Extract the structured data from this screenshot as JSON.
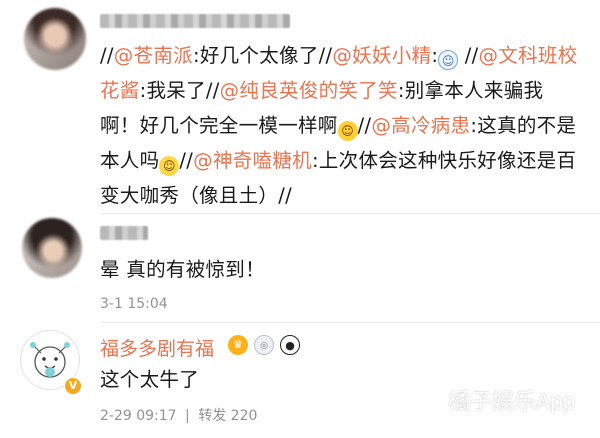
{
  "comments": [
    {
      "body_segments": [
        {
          "text": "//",
          "type": "plain"
        },
        {
          "text": "@苍南派",
          "type": "mention"
        },
        {
          "text": ":好几个太像了//",
          "type": "plain"
        },
        {
          "text": "@妖妖小精",
          "type": "mention"
        },
        {
          "text": ":",
          "type": "plain"
        },
        {
          "icon": "ghost-emoji",
          "type": "emoji"
        },
        {
          "text": " //",
          "type": "plain"
        },
        {
          "text": "@文科班校花酱",
          "type": "mention"
        },
        {
          "text": ":我呆了//",
          "type": "plain"
        },
        {
          "text": "@纯良英俊的笑了笑",
          "type": "mention"
        },
        {
          "text": ":别拿本人来骗我啊！好几个完全一模一样啊",
          "type": "plain"
        },
        {
          "icon": "laughing-tears-emoji",
          "type": "emoji"
        },
        {
          "text": "//",
          "type": "plain"
        },
        {
          "text": "@高冷病患",
          "type": "mention"
        },
        {
          "text": ":这真的不是本人吗",
          "type": "plain"
        },
        {
          "icon": "smug-emoji",
          "type": "emoji"
        },
        {
          "text": "//",
          "type": "plain"
        },
        {
          "text": "@神奇嗑糖机",
          "type": "mention"
        },
        {
          "text": ":上次体会这种快乐好像还是百变大咖秀（像且土）//",
          "type": "plain"
        }
      ]
    },
    {
      "body": "晕 真的有被惊到！",
      "timestamp": "3-1 15:04"
    },
    {
      "username": "福多多剧有福",
      "badges": [
        "crown-icon",
        "medal-icon",
        "panda-icon"
      ],
      "body": "这个太牛了",
      "timestamp": "2-29 09:17",
      "separator": "|",
      "repost_label": "转发",
      "repost_count": "220"
    }
  ],
  "watermark": "橘子娱乐App",
  "colors": {
    "mention": "#eb7350",
    "meta": "#939393",
    "text": "#1a1a1a"
  }
}
